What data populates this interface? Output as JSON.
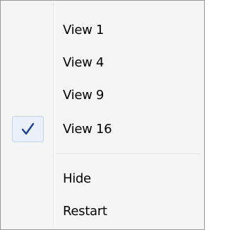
{
  "menu": {
    "items": [
      {
        "label": "View 1",
        "checked": false
      },
      {
        "label": "View 4",
        "checked": false
      },
      {
        "label": "View 9",
        "checked": false
      },
      {
        "label": "View 16",
        "checked": true
      },
      {
        "label": "Hide",
        "checked": false
      },
      {
        "label": "Restart",
        "checked": false
      }
    ],
    "check_icon": "checkmark-icon",
    "colors": {
      "background": "#f5f5f5",
      "border": "#979797",
      "check": "#1e3f8f",
      "check_highlight": "#eaf1fb"
    }
  }
}
